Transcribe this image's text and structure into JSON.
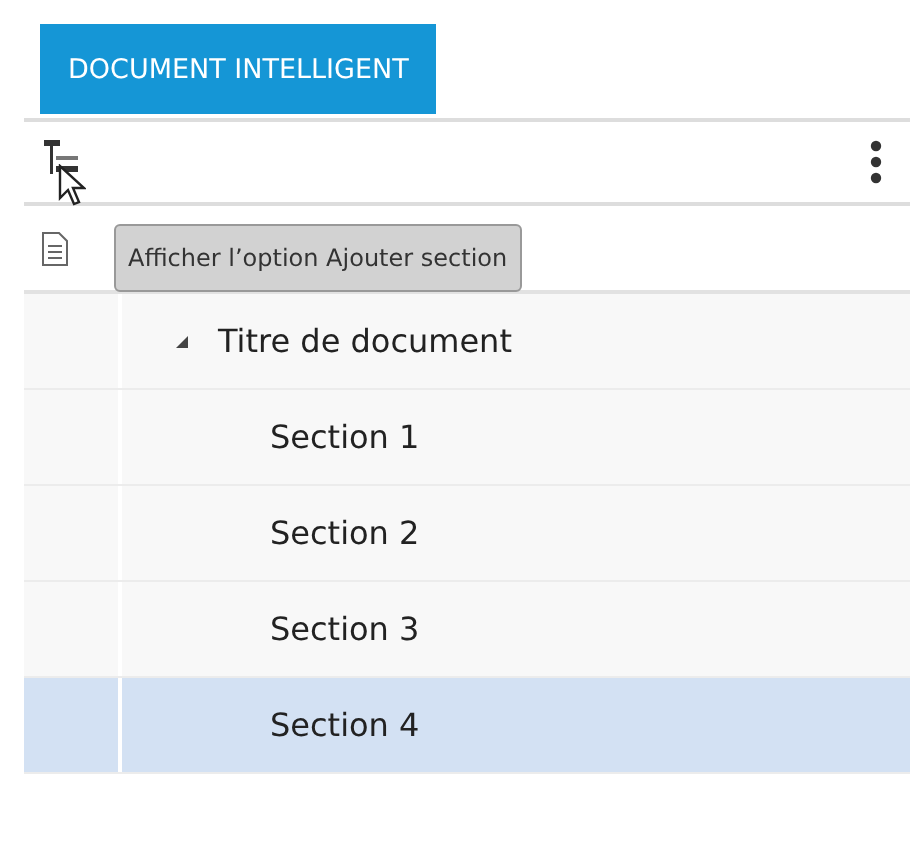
{
  "tab": {
    "label": "DOCUMENT INTELLIGENT",
    "selected": true
  },
  "tooltip": "Afficher l’option Ajouter section",
  "tree": [
    {
      "label": "Titre de document",
      "expanded": true,
      "selected": false,
      "children": [
        {
          "label": "Section 1",
          "selected": false
        },
        {
          "label": "Section 2",
          "selected": false
        },
        {
          "label": "Section 3",
          "selected": false
        },
        {
          "label": "Section 4",
          "selected": true
        }
      ]
    }
  ]
}
